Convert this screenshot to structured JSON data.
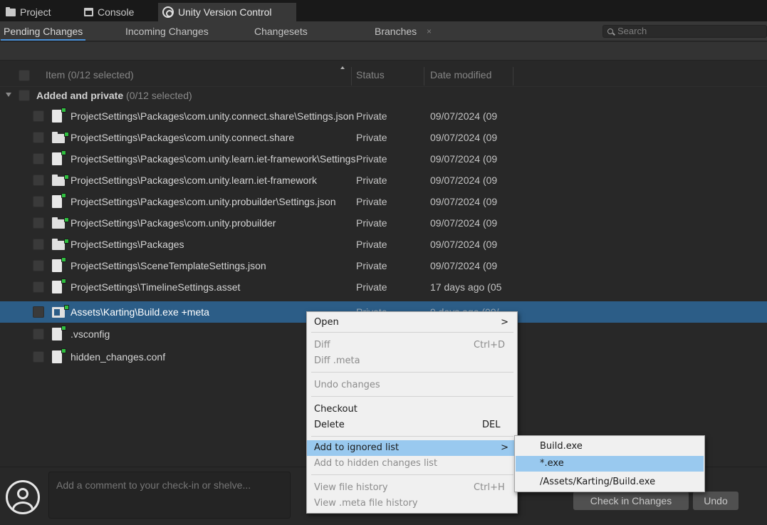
{
  "window_tabs": [
    {
      "label": "Project",
      "icon": "folder-icon"
    },
    {
      "label": "Console",
      "icon": "console-icon"
    },
    {
      "label": "Unity Version Control",
      "icon": "unity-version-control-icon"
    }
  ],
  "sub_tabs": [
    {
      "label": "Pending Changes"
    },
    {
      "label": "Incoming Changes"
    },
    {
      "label": "Changesets"
    },
    {
      "label": "Branches"
    }
  ],
  "sub_tab_close": "×",
  "search": {
    "placeholder": "Search"
  },
  "table": {
    "columns": [
      "Item (0/12 selected)",
      "Status",
      "Date modified"
    ],
    "group": {
      "name": "Added and private",
      "count": "(0/12 selected)"
    },
    "rows": [
      {
        "name": "ProjectSettings\\Packages\\com.unity.connect.share\\Settings.json",
        "status": "Private",
        "date": "09/07/2024 (09",
        "kind": "file"
      },
      {
        "name": "ProjectSettings\\Packages\\com.unity.connect.share",
        "status": "Private",
        "date": "09/07/2024 (09",
        "kind": "folder"
      },
      {
        "name": "ProjectSettings\\Packages\\com.unity.learn.iet-framework\\Settings.json",
        "status": "Private",
        "date": "09/07/2024 (09",
        "kind": "file"
      },
      {
        "name": "ProjectSettings\\Packages\\com.unity.learn.iet-framework",
        "status": "Private",
        "date": "09/07/2024 (09",
        "kind": "folder"
      },
      {
        "name": "ProjectSettings\\Packages\\com.unity.probuilder\\Settings.json",
        "status": "Private",
        "date": "09/07/2024 (09",
        "kind": "file"
      },
      {
        "name": "ProjectSettings\\Packages\\com.unity.probuilder",
        "status": "Private",
        "date": "09/07/2024 (09",
        "kind": "folder"
      },
      {
        "name": "ProjectSettings\\Packages",
        "status": "Private",
        "date": "09/07/2024 (09",
        "kind": "folder"
      },
      {
        "name": "ProjectSettings\\SceneTemplateSettings.json",
        "status": "Private",
        "date": "09/07/2024 (09",
        "kind": "file"
      },
      {
        "name": "ProjectSettings\\TimelineSettings.asset",
        "status": "Private",
        "date": "17 days ago (05",
        "kind": "file"
      },
      {
        "name": "Assets\\Karting\\Build.exe +meta",
        "status": "Private",
        "date": "9 days ago (09/",
        "kind": "exe",
        "selected": true
      },
      {
        "name": ".vsconfig",
        "status": "",
        "date": "",
        "kind": "file"
      },
      {
        "name": "hidden_changes.conf",
        "status": "",
        "date": "",
        "kind": "file"
      }
    ]
  },
  "comment": {
    "placeholder": "Add a comment to your check-in or shelve..."
  },
  "buttons": {
    "check_in": "Check in Changes",
    "undo": "Undo"
  },
  "context_menu": {
    "items": [
      {
        "label": "Open",
        "submenu_arrow": ">"
      },
      {
        "label": "Diff",
        "shortcut": "Ctrl+D"
      },
      {
        "label": "Diff .meta"
      },
      {
        "label": "Undo changes"
      },
      {
        "label": "Checkout"
      },
      {
        "label": "Delete",
        "shortcut": "DEL"
      },
      {
        "label": "Add to ignored list",
        "submenu_arrow": ">"
      },
      {
        "label": "Add to hidden changes list"
      },
      {
        "label": "View file history",
        "shortcut": "Ctrl+H"
      },
      {
        "label": "View .meta file history"
      }
    ]
  },
  "ignored_submenu": {
    "items": [
      {
        "label": "Build.exe"
      },
      {
        "label": "*.exe"
      },
      {
        "label": "/Assets/Karting/Build.exe"
      }
    ]
  },
  "colors": {
    "selection": "#2c5d87",
    "menu_highlight": "#99c9ef",
    "added_badge": "#2fbf3f",
    "tab_underline": "#4a90d9"
  }
}
